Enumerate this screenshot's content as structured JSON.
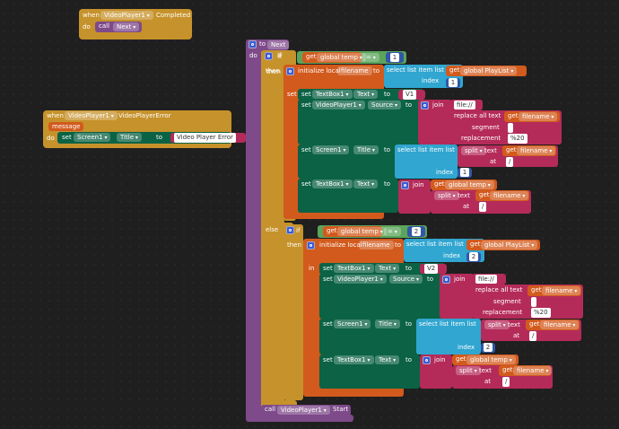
{
  "colors": {
    "event": "#c6922b",
    "proc": "#7e4a8a",
    "logic": "#5ba55b",
    "var": "#d25a1d",
    "list": "#30a6d0",
    "text": "#b42b5a",
    "comp": "#0b6244",
    "math": "#3157a6"
  },
  "completed": {
    "when": "when",
    "component": "VideoPlayer1",
    "event": "Completed",
    "do": "do",
    "call": "call",
    "proc": "Next"
  },
  "error": {
    "when": "when",
    "component": "VideoPlayer1",
    "event": "VideoPlayerError",
    "param": "message",
    "do": "do",
    "set": "set",
    "comp": "Screen1",
    "prop": "Title",
    "to": "to",
    "value": "Video Player Error"
  },
  "proc": {
    "to": "to",
    "name": "Next",
    "do": "do",
    "if": "if",
    "then": "then",
    "else": "else",
    "in": "in",
    "call": "call",
    "callComp": "VideoPlayer1",
    "callMethod": "Start"
  },
  "branches": [
    {
      "get": "get",
      "var": "global temp",
      "op": "=",
      "num": "1",
      "init": "initialize local",
      "local": "filename",
      "to": "to",
      "select": "select list item  list",
      "listVar": "global PlayList",
      "index": "index",
      "idx": "1",
      "tb": "TextBox1",
      "tbProp": "Text",
      "v": "V1",
      "vp": "VideoPlayer1",
      "vpProp": "Source",
      "join": "join",
      "file": "file://",
      "replace": "replace all text",
      "segment": "segment",
      "seg": " ",
      "replacement": "replacement",
      "rep": "%20",
      "scr": "Screen1",
      "scrProp": "Title",
      "split": "split",
      "textLbl": "text",
      "at": "at",
      "atVal": "/",
      "filename": "filename",
      "temp": "global temp",
      "set": "set"
    },
    {
      "get": "get",
      "var": "global temp",
      "op": "=",
      "num": "2",
      "init": "initialize local",
      "local": "filename",
      "to": "to",
      "select": "select list item  list",
      "listVar": "global PlayList",
      "index": "index",
      "idx": "2",
      "tb": "TextBox1",
      "tbProp": "Text",
      "v": "V2",
      "vp": "VideoPlayer1",
      "vpProp": "Source",
      "join": "join",
      "file": "file://",
      "replace": "replace all text",
      "segment": "segment",
      "seg": " ",
      "replacement": "replacement",
      "rep": "%20",
      "scr": "Screen1",
      "scrProp": "Title",
      "split": "split",
      "textLbl": "text",
      "at": "at",
      "atVal": "/",
      "filename": "filename",
      "temp": "global temp",
      "set": "set"
    }
  ]
}
